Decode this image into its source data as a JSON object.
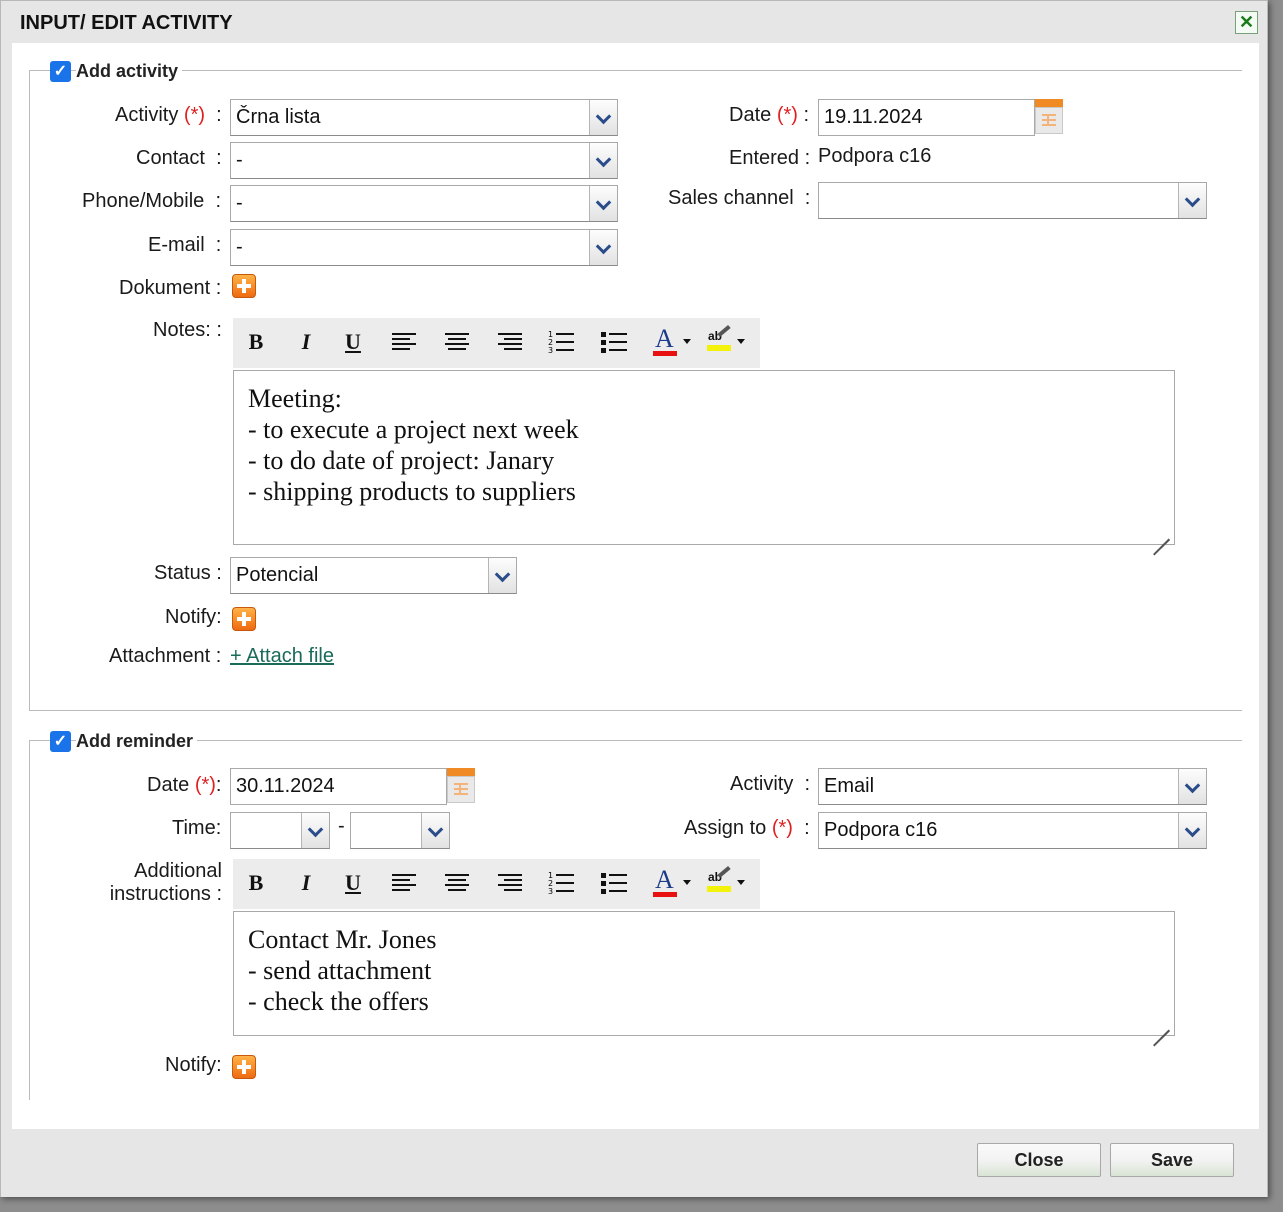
{
  "dialog": {
    "title": "INPUT/ EDIT ACTIVITY",
    "close_icon": "✕"
  },
  "activity_section": {
    "legend": "Add activity",
    "checked": "✓",
    "activity_label": "Activity",
    "req": "(*)",
    "colon": ":",
    "activity_value": "Črna lista",
    "contact_label": "Contact",
    "contact_value": "-",
    "phone_label": "Phone/Mobile",
    "phone_value": "-",
    "email_label": "E-mail",
    "email_value": "-",
    "dokument_label": "Dokument :",
    "date_label": "Date",
    "date_value": "19.11.2024",
    "entered_label": "Entered :",
    "entered_value": "Podpora c16",
    "sales_channel_label": "Sales channel",
    "sales_channel_value": "",
    "notes_label": "Notes: :",
    "notes_lines": [
      "Meeting:",
      "- to execute a project next week",
      "- to do date of project: Janary",
      "- shipping products to suppliers"
    ],
    "status_label": "Status :",
    "status_value": "Potencial",
    "notify_label": "Notify:",
    "attachment_label": "Attachment :",
    "attach_link": "+ Attach file"
  },
  "reminder_section": {
    "legend": "Add reminder",
    "checked": "✓",
    "date_label": "Date",
    "req": "(*)",
    "date_suffix": ":",
    "date_value": "30.11.2024",
    "time_label": "Time:",
    "time_sep": "-",
    "activity_label": "Activity",
    "colon": ":",
    "activity_value": "Email",
    "assign_label": "Assign to",
    "assign_value": "Podpora c16",
    "instructions_label_1": "Additional",
    "instructions_label_2": "instructions :",
    "instructions_lines": [
      "Contact Mr. Jones",
      "- send attachment",
      "- check the offers"
    ],
    "notify_label": "Notify:"
  },
  "toolbar": {
    "bold": "B",
    "italic": "I",
    "underline": "U",
    "font_color": "A",
    "highlight": "ab"
  },
  "colors": {
    "font_color_bar": "#e81010",
    "highlight_bar": "#f2f20a"
  },
  "footer": {
    "close_label": "Close",
    "save_label": "Save"
  }
}
